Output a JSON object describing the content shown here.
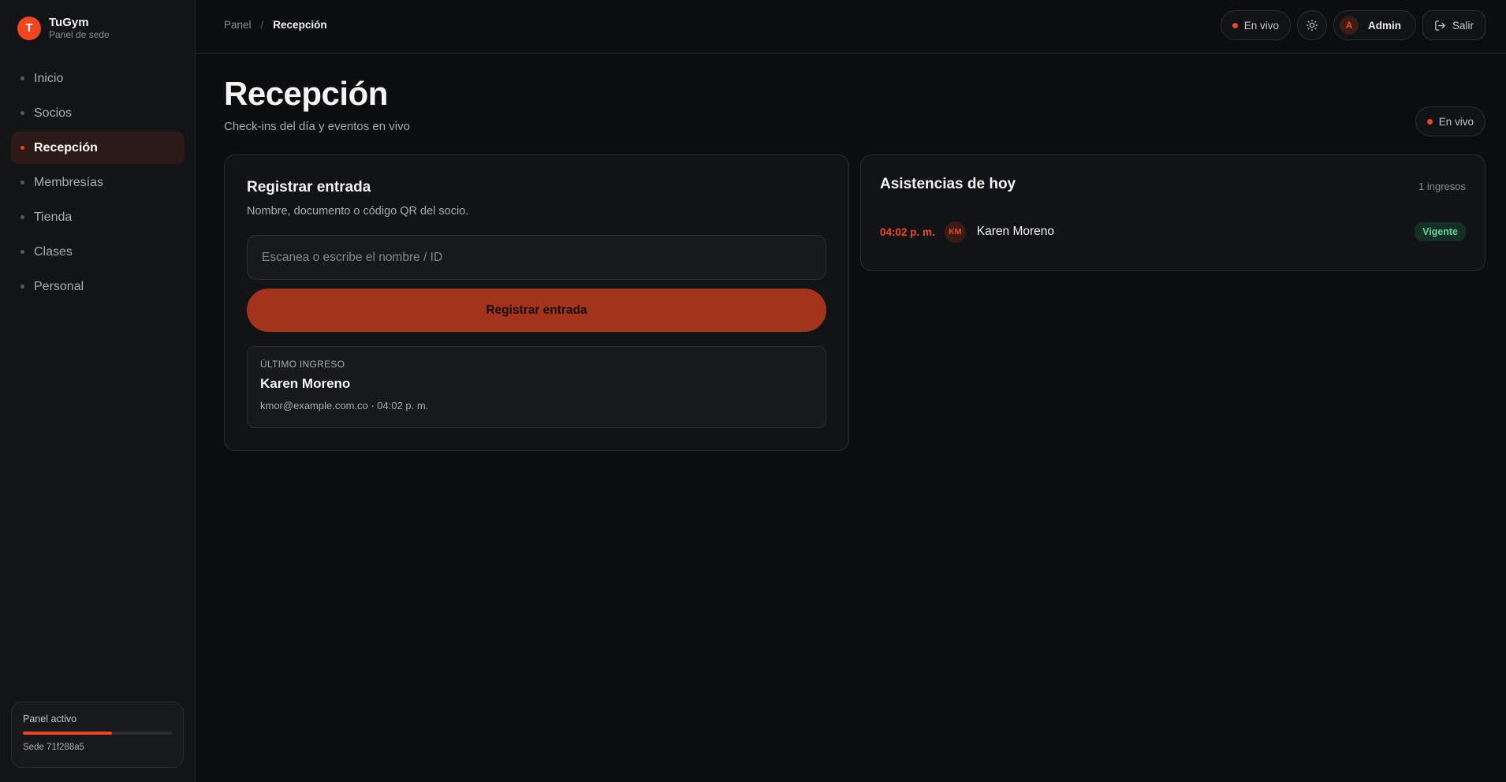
{
  "brand": {
    "logo_letter": "T",
    "name": "TuGym",
    "subtitle": "Panel de sede"
  },
  "sidebar": {
    "items": [
      {
        "label": "Inicio",
        "active": false
      },
      {
        "label": "Socios",
        "active": false
      },
      {
        "label": "Recepción",
        "active": true
      },
      {
        "label": "Membresías",
        "active": false
      },
      {
        "label": "Tienda",
        "active": false
      },
      {
        "label": "Clases",
        "active": false
      },
      {
        "label": "Personal",
        "active": false
      }
    ],
    "status_card": {
      "title": "Panel activo",
      "progress": 0.6,
      "subtitle": "Sede 71f288a5"
    }
  },
  "topbar": {
    "breadcrumb": {
      "root": "Panel",
      "separator": "/",
      "current": "Recepción"
    },
    "live_label": "En vivo",
    "theme_icon": "sun-icon",
    "user": {
      "initial": "A",
      "name": "Admin"
    },
    "exit_label": "Salir"
  },
  "page": {
    "title": "Recepción",
    "subtitle": "Check-ins del día y eventos en vivo",
    "live_label": "En vivo"
  },
  "checkin": {
    "title": "Registrar entrada",
    "subtitle": "Nombre, documento o código QR del socio.",
    "input_placeholder": "Escanea o escribe el nombre / ID",
    "button_label": "Registrar entrada",
    "last": {
      "label": "ÚLTIMO INGRESO",
      "name": "Karen Moreno",
      "meta": "kmor@example.com.co · 04:02 p. m."
    }
  },
  "attendance": {
    "title": "Asistencias de hoy",
    "count_label": "1 ingresos",
    "rows": [
      {
        "time": "04:02 p. m.",
        "initials": "KM",
        "name": "Karen Moreno",
        "status": "Vigente"
      }
    ]
  },
  "colors": {
    "accent": "#f0451f",
    "button": "#a3341c",
    "success": "#63d19a",
    "background": "#0c0d0f"
  }
}
